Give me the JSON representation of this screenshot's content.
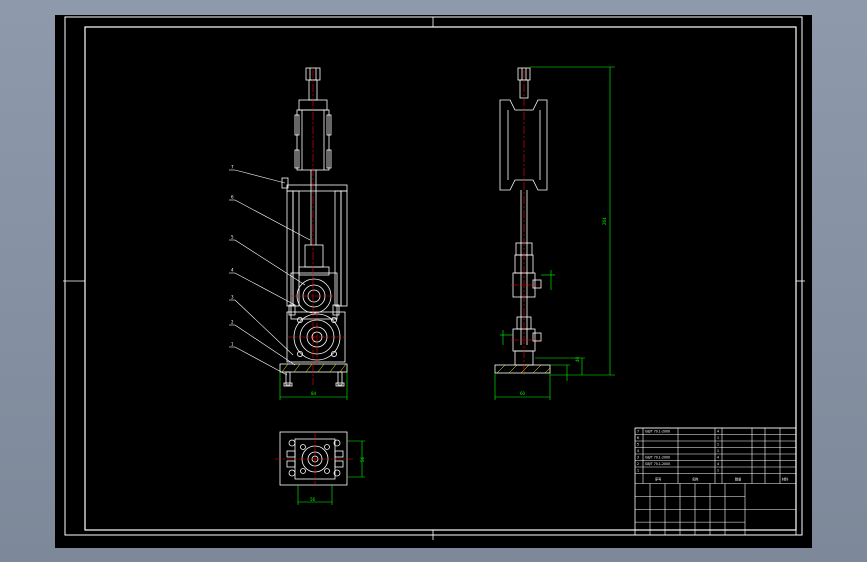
{
  "drawing": {
    "background": "#000000",
    "colors": {
      "frame": "#ffffff",
      "part": "#ffffff",
      "center": "#ff0000",
      "dimension": "#00ff00",
      "hatch": "#ffff00",
      "label": "#ffffff"
    },
    "callouts": [
      "7",
      "6",
      "5",
      "4",
      "3",
      "2",
      "1"
    ],
    "title_block": {
      "bom_rows": [
        {
          "no": "7",
          "code": "GB/T 70.1-2000",
          "name": "",
          "qty": "4",
          "material": ""
        },
        {
          "no": "6",
          "code": "",
          "name": "",
          "qty": "1",
          "material": ""
        },
        {
          "no": "5",
          "code": "",
          "name": "",
          "qty": "1",
          "material": ""
        },
        {
          "no": "4",
          "code": "",
          "name": "",
          "qty": "1",
          "material": ""
        },
        {
          "no": "3",
          "code": "GB/T 70.1-2000",
          "name": "",
          "qty": "4",
          "material": ""
        },
        {
          "no": "2",
          "code": "GB/T 70.1-2000",
          "name": "",
          "qty": "4",
          "material": ""
        },
        {
          "no": "1",
          "code": "",
          "name": "",
          "qty": "1",
          "material": ""
        }
      ],
      "header": {
        "no": "序号",
        "name": "名称",
        "qty": "数量",
        "material": "材料"
      },
      "drawing_name": "",
      "drawing_number": ""
    }
  }
}
